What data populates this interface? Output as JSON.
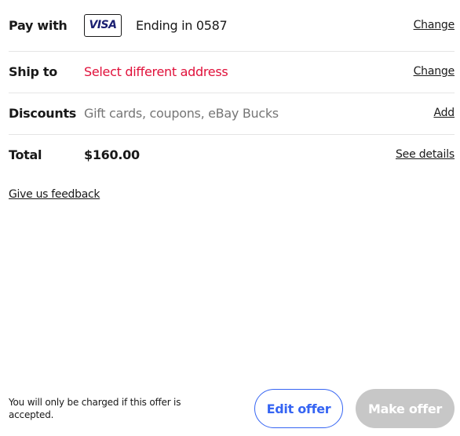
{
  "pay_with": {
    "label": "Pay with",
    "card_brand": "VISA",
    "card_text": "Ending in 0587",
    "action": "Change"
  },
  "ship_to": {
    "label": "Ship to",
    "value": "Select different address",
    "action": "Change"
  },
  "discounts": {
    "label": "Discounts",
    "placeholder": "Gift cards, coupons, eBay Bucks",
    "action": "Add"
  },
  "total": {
    "label": "Total",
    "amount": "$160.00",
    "action": "See details"
  },
  "feedback_link": "Give us feedback",
  "footer": {
    "note": "You will only be charged if this offer is accepted.",
    "edit_button": "Edit offer",
    "make_button": "Make offer"
  },
  "colors": {
    "alert": "#e0103a",
    "primary": "#3665f3",
    "disabled": "#c7c7c7",
    "visa": "#1a1f71"
  }
}
